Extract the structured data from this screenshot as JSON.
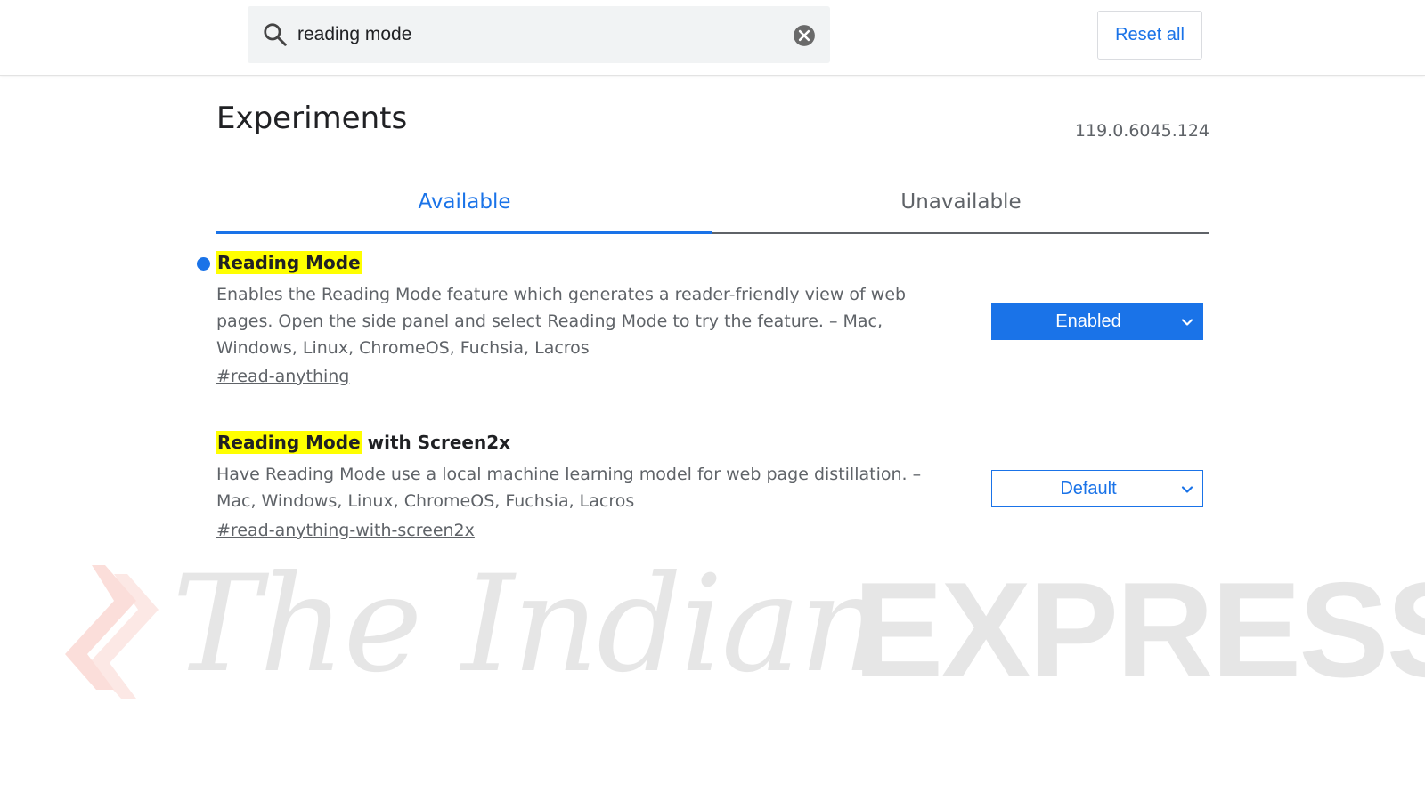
{
  "search": {
    "query": "reading mode"
  },
  "header": {
    "reset_label": "Reset all"
  },
  "page": {
    "title": "Experiments",
    "version": "119.0.6045.124"
  },
  "tabs": [
    {
      "label": "Available",
      "selected": true
    },
    {
      "label": "Unavailable",
      "selected": false
    }
  ],
  "experiments": [
    {
      "title_highlight": "Reading Mode",
      "title_rest": "",
      "description": "Enables the Reading Mode feature which generates a reader-friendly view of web pages. Open the side panel and select Reading Mode to try the feature. – Mac, Windows, Linux, ChromeOS, Fuchsia, Lacros",
      "link": "#read-anything",
      "state": "Enabled"
    },
    {
      "title_highlight": "Reading Mode",
      "title_rest": " with Screen2x",
      "description": "Have Reading Mode use a local machine learning model for web page distillation. – Mac, Windows, Linux, ChromeOS, Fuchsia, Lacros",
      "link": "#read-anything-with-screen2x",
      "state": "Default"
    }
  ],
  "watermark": {
    "word1": "The Indian",
    "word2": "EXPRESS"
  },
  "colors": {
    "accent": "#1a73e8",
    "highlight": "#ffff00",
    "text_secondary": "#5f6368"
  },
  "icons": {
    "search": "search-icon",
    "clear": "clear-icon",
    "dropdown": "chevron-down-icon",
    "modified": "modified-dot-icon"
  }
}
